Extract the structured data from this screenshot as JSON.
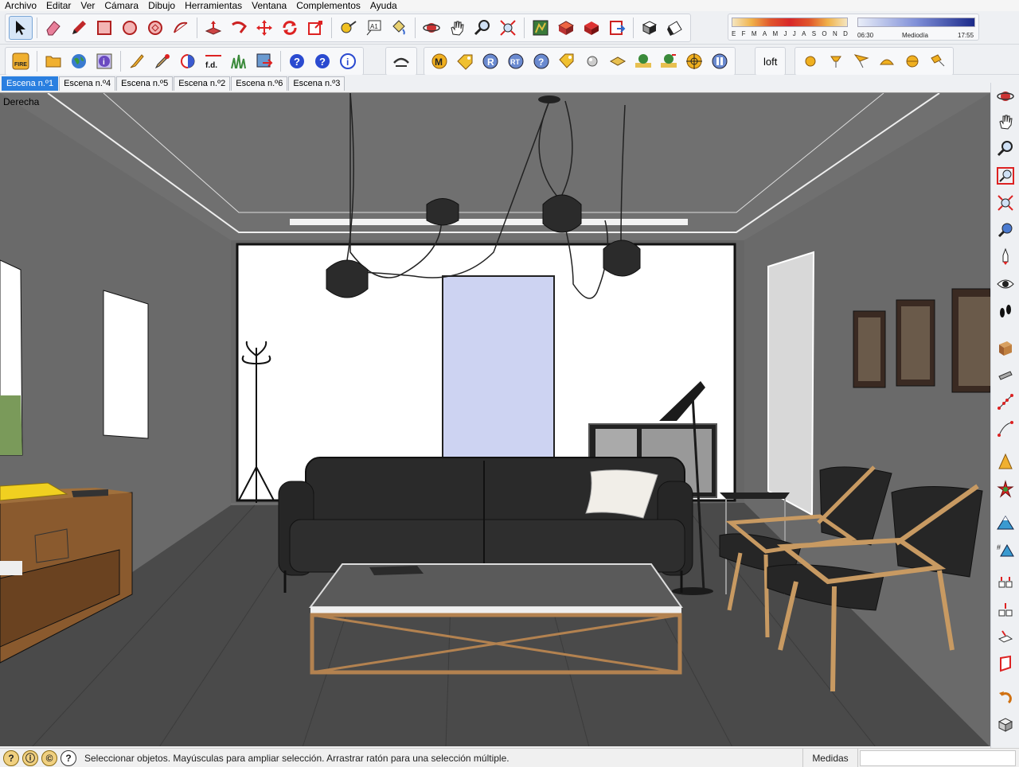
{
  "menu": [
    "Archivo",
    "Editar",
    "Ver",
    "Cámara",
    "Dibujo",
    "Herramientas",
    "Ventana",
    "Complementos",
    "Ayuda"
  ],
  "toolbar": {
    "loft_label": "loft",
    "fd_label": "f.d.",
    "fire_label": "FIRE"
  },
  "shadows": {
    "months": [
      "E",
      "F",
      "M",
      "A",
      "M",
      "J",
      "J",
      "A",
      "S",
      "O",
      "N",
      "D"
    ],
    "time_start": "06:30",
    "time_mid": "Mediodía",
    "time_end": "17:55"
  },
  "scene_tabs": [
    "Escena n.º1",
    "Escena n.º4",
    "Escena n.º5",
    "Escena n.º2",
    "Escena n.º6",
    "Escena n.º3"
  ],
  "active_scene": 0,
  "viewport": {
    "view_name": "Derecha"
  },
  "status": {
    "message": "Seleccionar objetos. Mayúsculas para ampliar selección. Arrastrar ratón para una selección múltiple.",
    "measure_label": "Medidas",
    "measure_value": ""
  },
  "colors": {
    "accent": "#2a7fe0",
    "wall": "#6e6e6e",
    "floor": "#4a4a4a",
    "back_wall": "#ffffff",
    "door": "#cdd3f2"
  }
}
